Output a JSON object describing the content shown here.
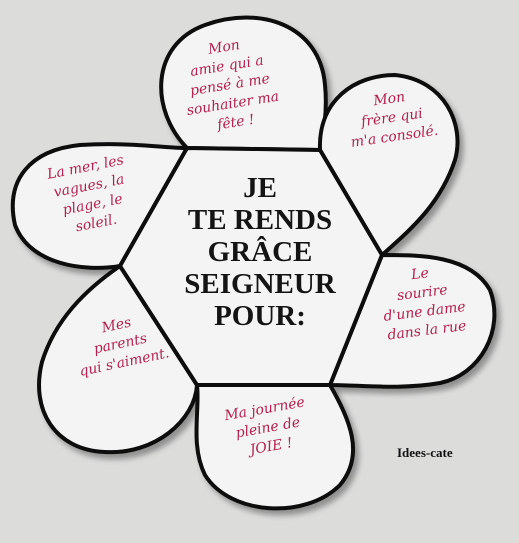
{
  "center": {
    "lines": [
      "JE",
      "TE RENDS",
      "GRÂCE",
      "SEIGNEUR",
      "POUR:"
    ]
  },
  "petals": {
    "top": [
      "Mon",
      "amie qui a",
      "pensé à me",
      "souhaiter ma",
      "fête !"
    ],
    "top_right": [
      "Mon",
      "frère qui",
      "m'a consolé."
    ],
    "right": [
      "Le",
      "sourire",
      "d'une dame",
      "dans la rue"
    ],
    "bottom": [
      "Ma journée",
      "pleine de",
      "JOIE !"
    ],
    "left_lower": [
      "Mes",
      "parents",
      "qui s'aiment."
    ],
    "left_upper": [
      "La mer, les",
      "vagues, la",
      "plage, le",
      "soleil."
    ]
  },
  "watermark": "Idees-cate",
  "colors": {
    "background": "#dcdcdb",
    "card": "#f4f4f4",
    "outline": "#111111",
    "handwriting": "#b3224e"
  }
}
